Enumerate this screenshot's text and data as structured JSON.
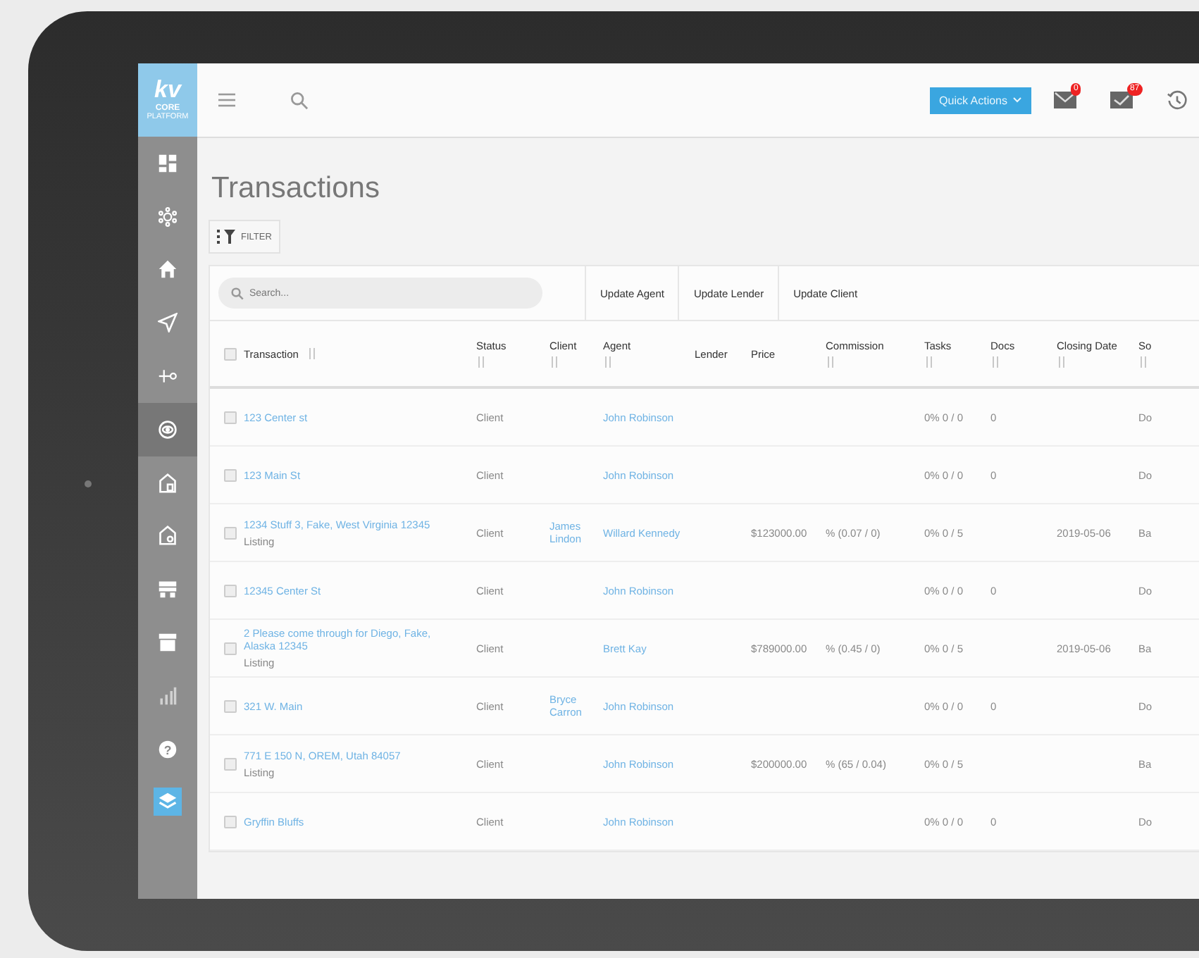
{
  "logo": {
    "mark": "kv",
    "line_1": "CORE",
    "line_2": "PLATFORM"
  },
  "sidebar": {
    "items": [
      {
        "selected": false,
        "accent": false
      },
      {
        "selected": false,
        "accent": false
      },
      {
        "selected": false,
        "accent": false
      },
      {
        "selected": false,
        "accent": false
      },
      {
        "selected": false,
        "accent": false
      },
      {
        "selected": true,
        "accent": false
      },
      {
        "selected": false,
        "accent": false
      },
      {
        "selected": false,
        "accent": false
      },
      {
        "selected": false,
        "accent": false
      },
      {
        "selected": false,
        "accent": false
      },
      {
        "selected": false,
        "accent": false
      },
      {
        "selected": false,
        "accent": false
      },
      {
        "selected": false,
        "accent": true
      }
    ],
    "help_mark": "?"
  },
  "topbar": {
    "quick_actions": "Quick Actions",
    "mail_badge": "0",
    "tasks_badge": "87"
  },
  "page_title": "Transactions",
  "filter_button": "FILTER",
  "search": {
    "placeholder": "Search..."
  },
  "actions": [
    "Update Agent",
    "Update Lender",
    "Update Client"
  ],
  "table": {
    "select_all_checked": false,
    "columns": [
      {
        "label": "Transaction",
        "sortable": true
      },
      {
        "label": "Status",
        "sortable": true
      },
      {
        "label": "Client",
        "sortable": true
      },
      {
        "label": "Agent",
        "sortable": true
      },
      {
        "label": "Lender",
        "sortable": false
      },
      {
        "label": "Price",
        "sortable": false
      },
      {
        "label": "Commission",
        "sortable": true
      },
      {
        "label": "Tasks",
        "sortable": true
      },
      {
        "label": "Docs",
        "sortable": true
      },
      {
        "label": "Closing Date",
        "sortable": true
      },
      {
        "label": "So",
        "sortable": true
      }
    ],
    "rows": [
      {
        "checked": false,
        "transaction": "123 Center st",
        "type": "",
        "status": "Client",
        "client": "",
        "agent": "John Robinson",
        "lender": "",
        "price": "",
        "commission": "",
        "tasks": "0% 0 / 0",
        "docs": "0",
        "closing_date": "",
        "source": "Do"
      },
      {
        "checked": false,
        "transaction": "123 Main St",
        "type": "",
        "status": "Client",
        "client": "",
        "agent": "John Robinson",
        "lender": "",
        "price": "",
        "commission": "",
        "tasks": "0% 0 / 0",
        "docs": "0",
        "closing_date": "",
        "source": "Do"
      },
      {
        "checked": false,
        "transaction": "1234 Stuff 3, Fake, West Virginia 12345",
        "type": "Listing",
        "status": "Client",
        "client": "James Lindon",
        "agent": "Willard Kennedy",
        "lender": "",
        "price": "$123000.00",
        "commission": "% (0.07 / 0)",
        "tasks": "0% 0 / 5",
        "docs": "",
        "closing_date": "2019-05-06",
        "source": "Ba"
      },
      {
        "checked": false,
        "transaction": "12345 Center St",
        "type": "",
        "status": "Client",
        "client": "",
        "agent": "John Robinson",
        "lender": "",
        "price": "",
        "commission": "",
        "tasks": "0% 0 / 0",
        "docs": "0",
        "closing_date": "",
        "source": "Do"
      },
      {
        "checked": false,
        "transaction": "2 Please come through for Diego, Fake, Alaska 12345",
        "type": "Listing",
        "status": "Client",
        "client": "",
        "agent": "Brett Kay",
        "lender": "",
        "price": "$789000.00",
        "commission": "% (0.45 / 0)",
        "tasks": "0% 0 / 5",
        "docs": "",
        "closing_date": "2019-05-06",
        "source": "Ba"
      },
      {
        "checked": false,
        "transaction": "321 W. Main",
        "type": "",
        "status": "Client",
        "client": "Bryce Carron",
        "agent": "John Robinson",
        "lender": "",
        "price": "",
        "commission": "",
        "tasks": "0% 0 / 0",
        "docs": "0",
        "closing_date": "",
        "source": "Do"
      },
      {
        "checked": false,
        "transaction": "771 E 150 N, OREM, Utah 84057",
        "type": "Listing",
        "status": "Client",
        "client": "",
        "agent": "John Robinson",
        "lender": "",
        "price": "$200000.00",
        "commission": "% (65 / 0.04)",
        "tasks": "0% 0 / 5",
        "docs": "",
        "closing_date": "",
        "source": "Ba"
      },
      {
        "checked": false,
        "transaction": "Gryffin Bluffs",
        "type": "",
        "status": "Client",
        "client": "",
        "agent": "John Robinson",
        "lender": "",
        "price": "",
        "commission": "",
        "tasks": "0% 0 / 0",
        "docs": "0",
        "closing_date": "",
        "source": "Do"
      }
    ]
  }
}
